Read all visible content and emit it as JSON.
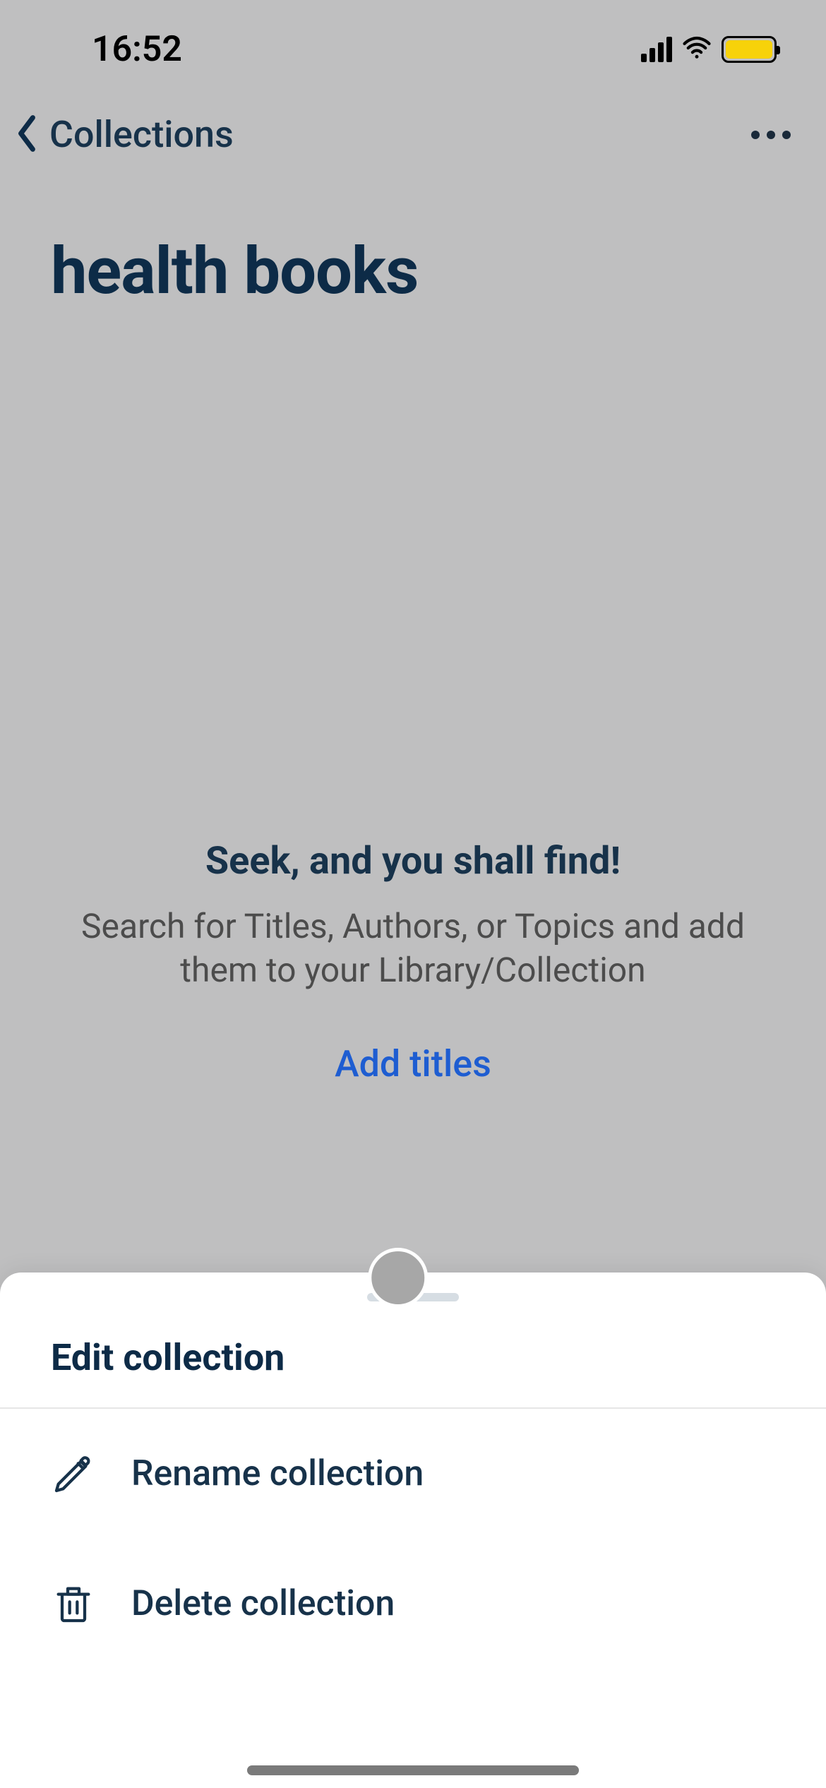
{
  "status_bar": {
    "time": "16:52"
  },
  "nav": {
    "back_label": "Collections"
  },
  "page": {
    "title": "health books"
  },
  "empty_state": {
    "headline": "Seek, and you shall find!",
    "subtext": "Search for Titles, Authors, or Topics and add them to your Library/Collection",
    "cta_label": "Add titles"
  },
  "sheet": {
    "title": "Edit collection",
    "items": [
      {
        "label": "Rename collection"
      },
      {
        "label": "Delete collection"
      }
    ]
  }
}
